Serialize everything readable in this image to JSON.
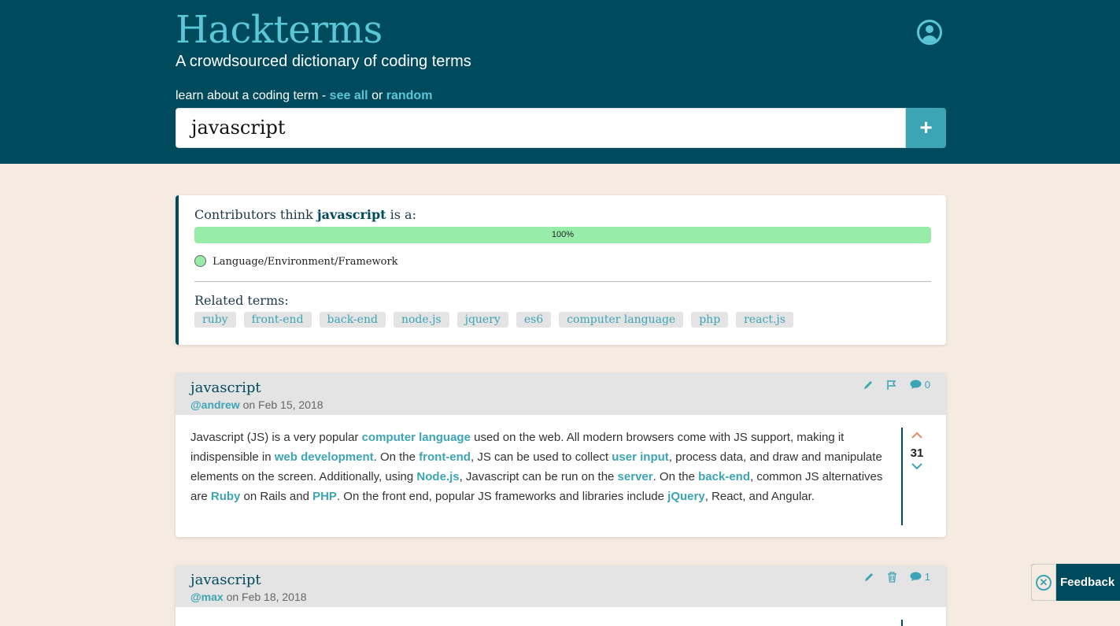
{
  "header": {
    "logo": "Hackterms",
    "tagline": "A crowdsourced dictionary of coding terms",
    "learn_prefix": "learn about a coding term -",
    "see_all": "see all",
    "or": "or",
    "random": "random",
    "search_value": "javascript",
    "add_symbol": "+"
  },
  "summary": {
    "think_prefix": "Contributors think",
    "term": "javascript",
    "think_suffix": "is a:",
    "bar_percent": "100%",
    "bar_fraction": 1.0,
    "category": "Language/Environment/Framework",
    "category_color": "#98ecaa",
    "related_label": "Related terms:",
    "related": [
      "ruby",
      "front-end",
      "back-end",
      "node.js",
      "jquery",
      "es6",
      "computer language",
      "php",
      "react.js"
    ]
  },
  "entries": [
    {
      "title": "javascript",
      "author": "@andrew",
      "on": "on Feb 15, 2018",
      "comments": "0",
      "votes": "31"
    },
    {
      "title": "javascript",
      "author": "@max",
      "on": "on Feb 18, 2018",
      "comments": "1"
    }
  ],
  "entry1_body": {
    "t1": "Javascript (JS) is a very popular ",
    "l1": "computer language",
    "t2": " used on the web. All modern browsers come with JS support, making it indispensible in ",
    "l2": "web development",
    "t3": ". On the ",
    "l3": "front-end",
    "t4": ", JS can be used to collect ",
    "l4": "user input",
    "t5": ", process data, and draw and manipulate elements on the screen. Additionally, using ",
    "l5": "Node.js",
    "t6": ", Javascript can be run on the ",
    "l6": "server",
    "t7": ". On the ",
    "l7": "back-end",
    "t8": ", common JS alternatives are ",
    "l8": "Ruby",
    "t9": " on Rails and ",
    "l9": "PHP",
    "t10": ". On the front end, popular JS frameworks and libraries include ",
    "l10": "jQuery",
    "t11": ", React, and Angular."
  },
  "feedback": {
    "label": "Feedback"
  },
  "colors": {
    "header_bg": "#004a5e",
    "accent": "#3da4b5",
    "page_bg": "#f5ebe1"
  }
}
